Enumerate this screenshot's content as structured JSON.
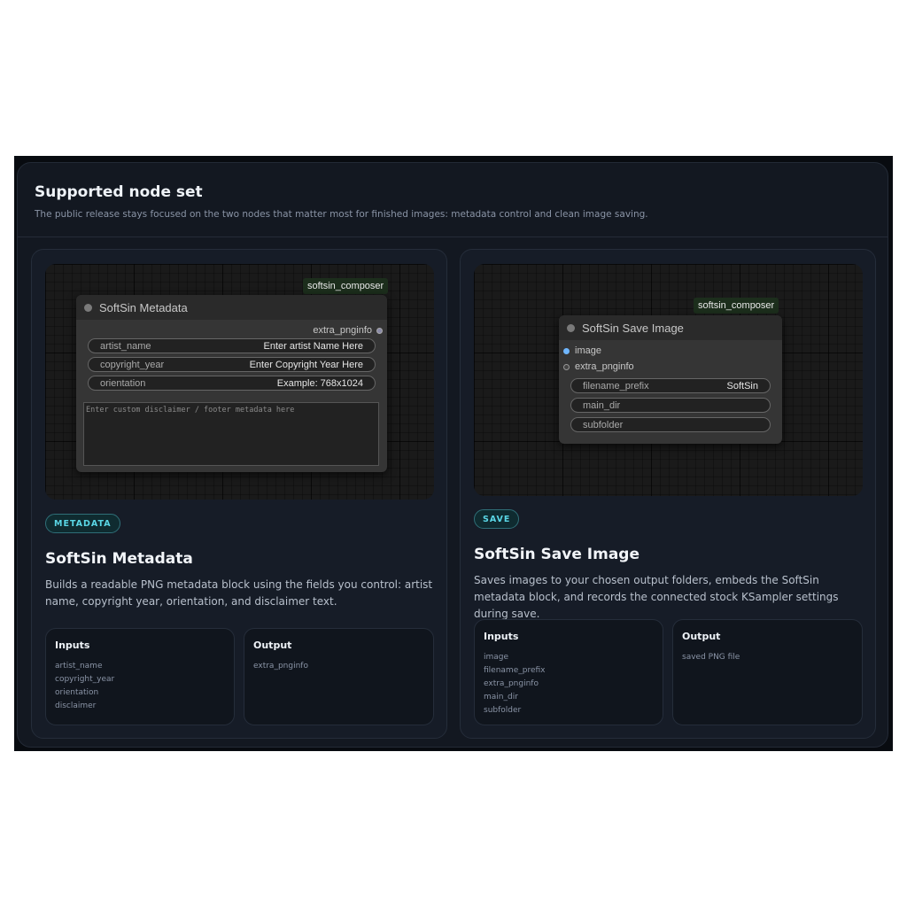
{
  "section": {
    "title": "Supported node set",
    "subtitle": "The public release stays focused on the two nodes that matter most for finished images: metadata control and clean image saving."
  },
  "cards": [
    {
      "preview": {
        "tag": "softsin_composer",
        "node_title": "SoftSin Metadata",
        "output_slot": "extra_pnginfo",
        "widgets": [
          {
            "label": "artist_name",
            "value": "Enter artist Name Here"
          },
          {
            "label": "copyright_year",
            "value": "Enter Copyright Year Here"
          },
          {
            "label": "orientation",
            "value": "Example: 768x1024"
          }
        ],
        "textarea_placeholder": "Enter custom disclaimer / footer metadata here"
      },
      "badge": "METADATA",
      "title": "SoftSin Metadata",
      "description": "Builds a readable PNG metadata block using the fields you control: artist name, copyright year, orientation, and disclaimer text.",
      "inputs_title": "Inputs",
      "inputs": [
        "artist_name",
        "copyright_year",
        "orientation",
        "disclaimer"
      ],
      "output_title": "Output",
      "outputs": [
        "extra_pnginfo"
      ]
    },
    {
      "preview": {
        "tag": "softsin_composer",
        "node_title": "SoftSin Save Image",
        "input_slots": [
          "image",
          "extra_pnginfo"
        ],
        "widgets": [
          {
            "label": "filename_prefix",
            "value": "SoftSin"
          },
          {
            "label": "main_dir",
            "value": ""
          },
          {
            "label": "subfolder",
            "value": ""
          }
        ]
      },
      "badge": "SAVE",
      "title": "SoftSin Save Image",
      "description": "Saves images to your chosen output folders, embeds the SoftSin metadata block, and records the connected stock KSampler settings during save.",
      "inputs_title": "Inputs",
      "inputs": [
        "image",
        "filename_prefix",
        "extra_pnginfo",
        "main_dir",
        "subfolder"
      ],
      "output_title": "Output",
      "outputs": [
        "saved PNG file"
      ]
    }
  ],
  "colors": {
    "accent": "#5ad7e6",
    "image_slot": "#6fb6ff",
    "panel_bg": "#131821"
  }
}
